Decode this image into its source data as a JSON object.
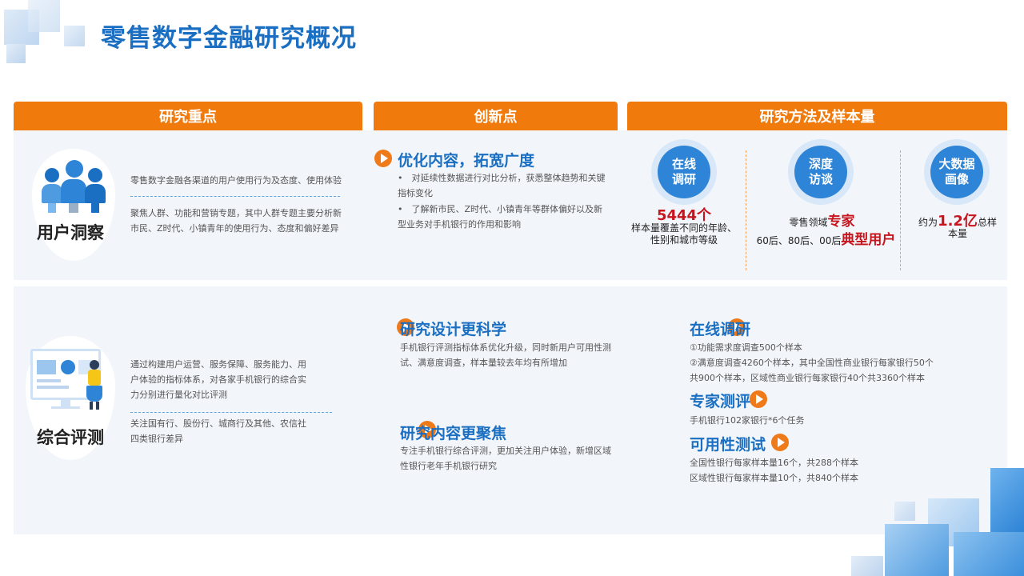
{
  "page": {
    "title": "零售数字金融研究概况"
  },
  "headers": {
    "focus": "研究重点",
    "innovation": "创新点",
    "method": "研究方法及样本量"
  },
  "top": {
    "label": "用户洞察",
    "desc1": "零售数字金融各渠道的用户使用行为及态度、使用体验",
    "desc2": "聚焦人群、功能和营销专题，其中人群专题主要分析新市民、Z时代、小镇青年的使用行为、态度和偏好差异",
    "innovation": {
      "title": "优化内容，拓宽广度",
      "bullet1": "•　对延续性数据进行对比分析，获悉整体趋势和关键指标变化",
      "bullet2": "•　了解新市民、Z时代、小镇青年等群体偏好以及新型业务对手机银行的作用和影响"
    },
    "methods": {
      "m1": {
        "line1": "在线",
        "line2": "调研",
        "count": "5444个",
        "desc": "样本量覆盖不同的年龄、性别和城市等级"
      },
      "m2": {
        "line1": "深度",
        "line2": "访谈",
        "pre": "零售领域",
        "strong1": "专家",
        "pre2": "60后、80后、00后",
        "strong2": "典型用户"
      },
      "m3": {
        "line1": "大数据",
        "line2": "画像",
        "pre": "约为",
        "strong": "1.2亿",
        "post": "总样",
        "post2": "本量"
      }
    }
  },
  "bottom": {
    "label": "综合评测",
    "desc1": "通过构建用户运营、服务保障、服务能力、用户体验的指标体系，对各家手机银行的综合实力分别进行量化对比评测",
    "desc2": "关注国有行、股份行、城商行及其他、农信社四类银行差异",
    "innovation1": {
      "title": "研究设计更科学",
      "text": "手机银行评测指标体系优化升级，同时新用户可用性测试、满意度调查，样本量较去年均有所增加"
    },
    "innovation2": {
      "title": "研究内容更聚焦",
      "text": "专注手机银行综合评测，更加关注用户体验，新增区域性银行老年手机银行研究"
    },
    "methods": {
      "online": {
        "title": "在线调研",
        "line1": "①功能需求度调查500个样本",
        "line2": "②满意度调查4260个样本，其中全国性商业银行每家银行50个共900个样本，区域性商业银行每家银行40个共3360个样本"
      },
      "expert": {
        "title": "专家测评",
        "line1": "手机银行102家银行*6个任务"
      },
      "usability": {
        "title": "可用性测试",
        "line1": "全国性银行每家样本量16个，共288个样本",
        "line2": "区域性银行每家样本量10个，共840个样本"
      }
    }
  },
  "colors": {
    "accent_orange": "#f07a0c",
    "title_blue": "#1b6fc2",
    "highlight_red": "#c8151d",
    "panel_bg": "#f2f6fb"
  }
}
